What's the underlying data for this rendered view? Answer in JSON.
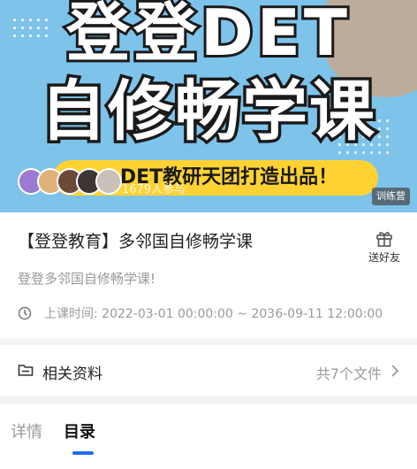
{
  "banner": {
    "line1": "登登DET",
    "line2": "自修畅学课",
    "slogan": "DET教研天团打造出品！",
    "participants": "1679人参与",
    "camp_tag": "训练营",
    "colors": {
      "background": "#7ec3ea",
      "slogan_bg": "#ffd233"
    }
  },
  "course": {
    "title": "【登登教育】多邻国自修畅学课",
    "gift_label": "送好友",
    "gift_icon": "gift-icon",
    "description": "登登多邻国自修畅学课!",
    "time_label": "上课时间: 2022-03-01 00:00:00 ~ 2036-09-11 12:00:00",
    "clock_icon": "clock-icon"
  },
  "materials": {
    "label": "相关资料",
    "count": "共7个文件",
    "folder_icon": "folder-icon",
    "arrow_icon": "chevron-right-icon"
  },
  "tabs": [
    {
      "label": "详情",
      "active": false
    },
    {
      "label": "目录",
      "active": true
    }
  ],
  "accent": "#1f6cf0"
}
